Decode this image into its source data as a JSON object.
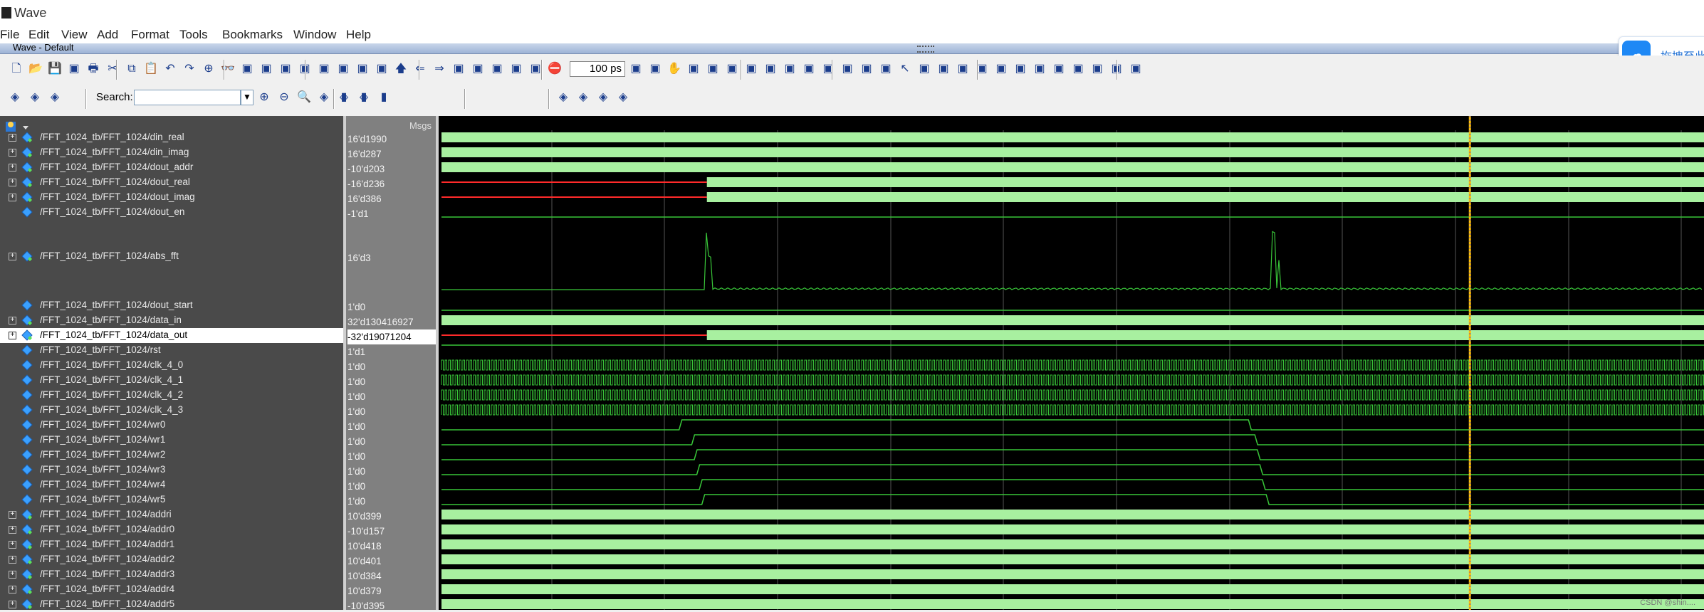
{
  "window": {
    "title": "Wave",
    "pane_title": "Wave - Default"
  },
  "menu": [
    "File",
    "Edit",
    "View",
    "Add",
    "Format",
    "Tools",
    "Bookmarks",
    "Window",
    "Help"
  ],
  "cloud_button": {
    "label": "拖拽至此"
  },
  "toolbar": {
    "time_step": "100 ps",
    "search_label": "Search:",
    "search_value": ""
  },
  "icons": {
    "tb1": [
      "new-icon",
      "open-icon",
      "save-icon",
      "reload-icon",
      "print-icon",
      "cut-icon",
      "copy-icon",
      "paste-icon",
      "undo-icon",
      "redo-icon",
      "find-icon",
      "binoculars-icon",
      "outline-icon",
      "layer-icon",
      "compile-icon",
      "simulate-icon",
      "break-icon",
      "delete-icon",
      "cascade-icon",
      "layout-icon",
      "up-arrow-icon",
      "back-arrow-icon",
      "forward-arrow-icon",
      "restart-icon",
      "run-icon",
      "continue-icon",
      "run-all-icon",
      "break-sim-icon",
      "stop-icon",
      "compile-all-icon",
      "sim-all-icon",
      "hand-icon",
      "step-icon",
      "step-over-icon",
      "step-out-icon",
      "step-into-icon",
      "step-back-icon",
      "step-up-icon",
      "bookmark-icon",
      "bookmark-add-icon",
      "bookmark-edit-icon",
      "bookmark-del-icon",
      "bookmark-go-icon",
      "pointer-icon",
      "zoom-mode-icon",
      "pan-icon",
      "edit-wave-icon",
      "split-icon",
      "cursor-add-icon",
      "prev-edge-icon",
      "next-edge-icon",
      "prev-transition-icon",
      "next-transition-icon",
      "first-edge-icon",
      "last-edge-icon",
      "falling-edge-icon"
    ],
    "tb2": [
      "insert-cursor-icon",
      "expand-icon",
      "collapse-icon",
      "zoom-in-icon",
      "zoom-out-icon",
      "zoom-full-icon",
      "zoom-cursor-icon",
      "zoom-last-icon",
      "zoom-range-icon",
      "wave-style-1-icon",
      "wave-style-2-icon",
      "wave-style-3-icon",
      "mode-1-icon",
      "mode-2-icon",
      "mode-3-icon",
      "mode-4-icon"
    ]
  },
  "columns": {
    "values_header": "Msgs"
  },
  "signals": [
    {
      "name": "/FFT_1024_tb/FFT_1024/din_real",
      "value": "16'd1990",
      "expand": true,
      "type": "bus"
    },
    {
      "name": "/FFT_1024_tb/FFT_1024/din_imag",
      "value": "16'd287",
      "expand": true,
      "type": "bus"
    },
    {
      "name": "/FFT_1024_tb/FFT_1024/dout_addr",
      "value": "-10'd203",
      "expand": true,
      "type": "bus"
    },
    {
      "name": "/FFT_1024_tb/FFT_1024/dout_real",
      "value": "-16'd236",
      "expand": true,
      "type": "bus"
    },
    {
      "name": "/FFT_1024_tb/FFT_1024/dout_imag",
      "value": "16'd386",
      "expand": true,
      "type": "bus"
    },
    {
      "name": "/FFT_1024_tb/FFT_1024/dout_en",
      "value": "-1'd1",
      "expand": false,
      "type": "bit"
    },
    {
      "name": "/FFT_1024_tb/FFT_1024/abs_fft",
      "value": "16'd3",
      "expand": true,
      "type": "analog"
    },
    {
      "name": "/FFT_1024_tb/FFT_1024/dout_start",
      "value": "1'd0",
      "expand": false,
      "type": "bit"
    },
    {
      "name": "/FFT_1024_tb/FFT_1024/data_in",
      "value": "32'd130416927",
      "expand": true,
      "type": "bus"
    },
    {
      "name": "/FFT_1024_tb/FFT_1024/data_out",
      "value": "-32'd19071204",
      "expand": true,
      "type": "bus",
      "selected": true
    },
    {
      "name": "/FFT_1024_tb/FFT_1024/rst",
      "value": "1'd1",
      "expand": false,
      "type": "bit"
    },
    {
      "name": "/FFT_1024_tb/FFT_1024/clk_4_0",
      "value": "1'd0",
      "expand": false,
      "type": "clock"
    },
    {
      "name": "/FFT_1024_tb/FFT_1024/clk_4_1",
      "value": "1'd0",
      "expand": false,
      "type": "clock"
    },
    {
      "name": "/FFT_1024_tb/FFT_1024/clk_4_2",
      "value": "1'd0",
      "expand": false,
      "type": "clock"
    },
    {
      "name": "/FFT_1024_tb/FFT_1024/clk_4_3",
      "value": "1'd0",
      "expand": false,
      "type": "clock"
    },
    {
      "name": "/FFT_1024_tb/FFT_1024/wr0",
      "value": "1'd0",
      "expand": false,
      "type": "pulse",
      "pulse": [
        0.19,
        0.64
      ]
    },
    {
      "name": "/FFT_1024_tb/FFT_1024/wr1",
      "value": "1'd0",
      "expand": false,
      "type": "pulse",
      "pulse": [
        0.2,
        0.645
      ]
    },
    {
      "name": "/FFT_1024_tb/FFT_1024/wr2",
      "value": "1'd0",
      "expand": false,
      "type": "pulse",
      "pulse": [
        0.202,
        0.647
      ]
    },
    {
      "name": "/FFT_1024_tb/FFT_1024/wr3",
      "value": "1'd0",
      "expand": false,
      "type": "pulse",
      "pulse": [
        0.204,
        0.649
      ]
    },
    {
      "name": "/FFT_1024_tb/FFT_1024/wr4",
      "value": "1'd0",
      "expand": false,
      "type": "pulse",
      "pulse": [
        0.206,
        0.651
      ]
    },
    {
      "name": "/FFT_1024_tb/FFT_1024/wr5",
      "value": "1'd0",
      "expand": false,
      "type": "pulse",
      "pulse": [
        0.208,
        0.654
      ]
    },
    {
      "name": "/FFT_1024_tb/FFT_1024/addri",
      "value": "10'd399",
      "expand": true,
      "type": "bus"
    },
    {
      "name": "/FFT_1024_tb/FFT_1024/addr0",
      "value": "-10'd157",
      "expand": true,
      "type": "bus"
    },
    {
      "name": "/FFT_1024_tb/FFT_1024/addr1",
      "value": "10'd418",
      "expand": true,
      "type": "bus"
    },
    {
      "name": "/FFT_1024_tb/FFT_1024/addr2",
      "value": "10'd401",
      "expand": true,
      "type": "bus"
    },
    {
      "name": "/FFT_1024_tb/FFT_1024/addr3",
      "value": "10'd384",
      "expand": true,
      "type": "bus"
    },
    {
      "name": "/FFT_1024_tb/FFT_1024/addr4",
      "value": "10'd379",
      "expand": true,
      "type": "bus"
    },
    {
      "name": "/FFT_1024_tb/FFT_1024/addr5",
      "value": "-10'd395",
      "expand": true,
      "type": "bus"
    }
  ],
  "wave": {
    "cursor_fraction": 0.815,
    "red_until_fraction": 0.212,
    "colors": {
      "bus": "#a8f0a0",
      "line": "#39c639",
      "red": "#ff2a2a",
      "cursor": "#ffc000",
      "grid": "#555555"
    }
  },
  "watermark": "CSDN @shin...."
}
